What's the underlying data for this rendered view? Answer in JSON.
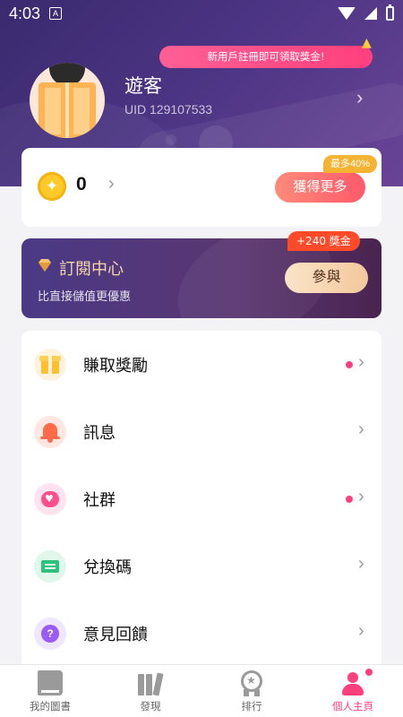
{
  "status_bar": {
    "time": "4:03",
    "notif_glyph": "A"
  },
  "banner": {
    "text": "新用戶註冊即可領取獎金!"
  },
  "profile": {
    "name": "遊客",
    "uid": "UID 129107533"
  },
  "coins": {
    "value": "0",
    "max_badge": "最多40%",
    "get_more": "獲得更多"
  },
  "subscription": {
    "title": "訂閱中心",
    "subtitle": "比直接儲值更優惠",
    "bonus_badge": "+240 獎金",
    "join": "參與"
  },
  "menu": {
    "items": [
      {
        "label": "賺取獎勵",
        "icon": "gift-icon",
        "has_dot": true
      },
      {
        "label": "訊息",
        "icon": "bell-icon",
        "has_dot": false
      },
      {
        "label": "社群",
        "icon": "heart-chat-icon",
        "has_dot": true
      },
      {
        "label": "兌換碼",
        "icon": "ticket-icon",
        "has_dot": false
      },
      {
        "label": "意見回饋",
        "icon": "question-icon",
        "has_dot": false
      }
    ]
  },
  "bottom_nav": {
    "items": [
      {
        "label": "我的圖書",
        "icon": "book-icon",
        "active": false
      },
      {
        "label": "發現",
        "icon": "bookshelf-icon",
        "active": false
      },
      {
        "label": "排行",
        "icon": "medal-icon",
        "active": false
      },
      {
        "label": "個人主頁",
        "icon": "person-icon",
        "active": true
      }
    ]
  },
  "colors": {
    "accent": "#ff3f7e",
    "header": "#4b3483",
    "gold": "#ffc928"
  }
}
